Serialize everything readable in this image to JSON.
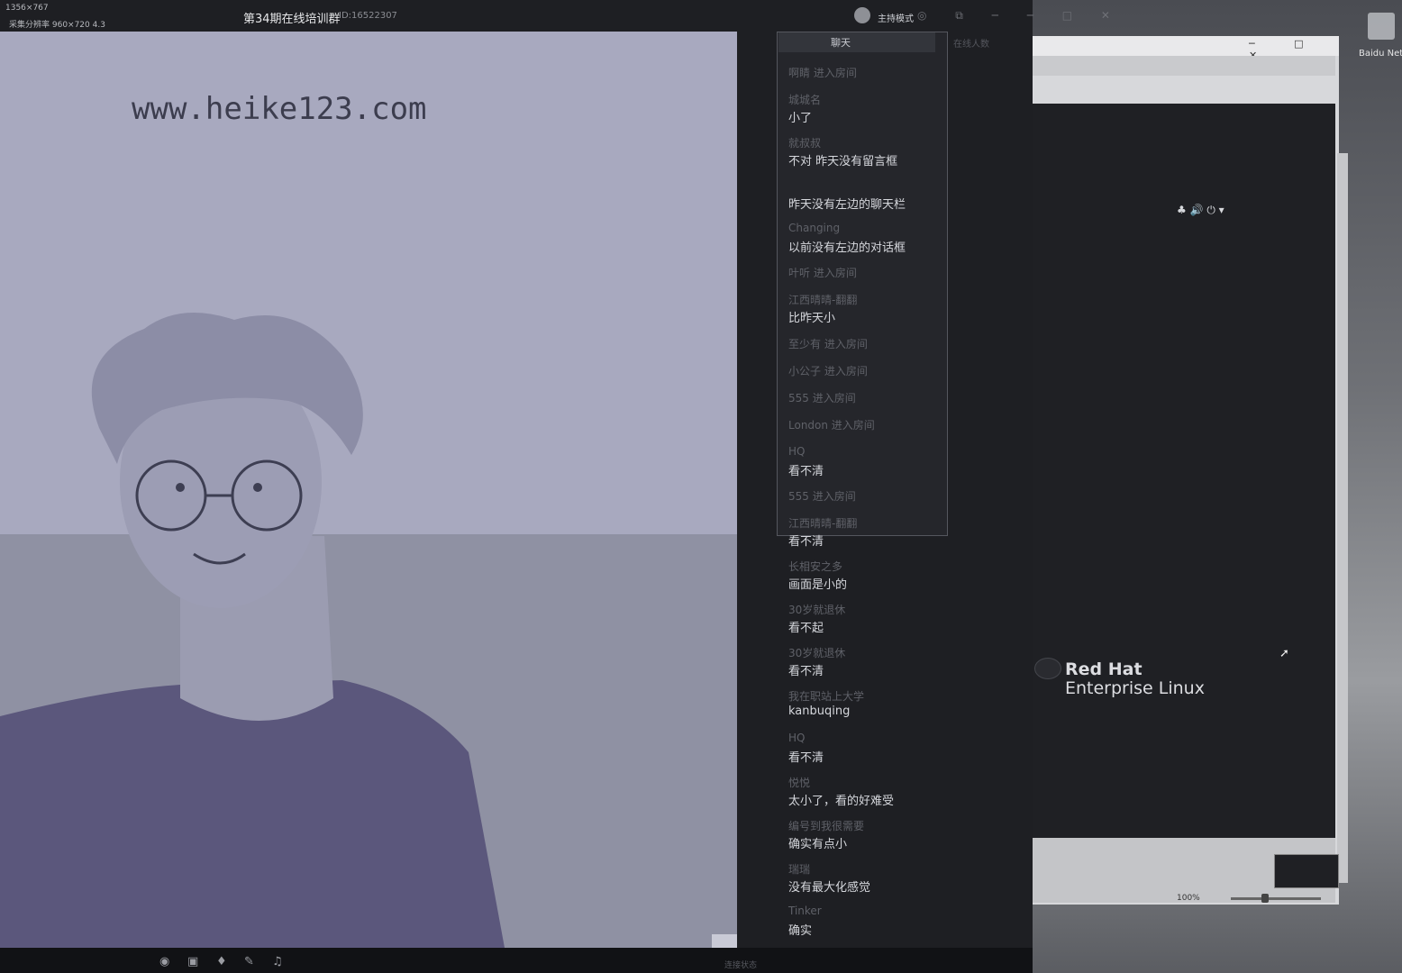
{
  "app": {
    "title": "第34期在线培训群",
    "id_label": "ID:16522307",
    "dimensions": "1356×767",
    "resolution_note": "采集分辨率 960×720 4.3",
    "host_mode": "主持模式",
    "window_icons": "◎ ⧉ ─ ─ □ ✕"
  },
  "video": {
    "watermark": "www.heike123.com"
  },
  "chat": {
    "tab_label": "聊天",
    "tab2_label": "在线人数",
    "messages": [
      {
        "kind": "join",
        "text": "啊睛 进入房间"
      },
      {
        "kind": "msg",
        "name": "城城名",
        "text": "小了"
      },
      {
        "kind": "msg",
        "name": "就叔叔",
        "text": "不对 昨天没有留言框"
      },
      {
        "kind": "msg",
        "name": "",
        "text": "昨天没有左边的聊天栏"
      },
      {
        "kind": "msg",
        "name": "Changing",
        "text": "以前没有左边的对话框"
      },
      {
        "kind": "join",
        "text": "叶听 进入房间"
      },
      {
        "kind": "msg",
        "name": "江西晴晴-翻翻",
        "text": "比昨天小"
      },
      {
        "kind": "join",
        "text": "至少有 进入房间"
      },
      {
        "kind": "join",
        "text": "小公子 进入房间"
      },
      {
        "kind": "join",
        "text": "555 进入房间"
      },
      {
        "kind": "join",
        "text": "London 进入房间"
      },
      {
        "kind": "msg",
        "name": "HQ",
        "text": "看不清"
      },
      {
        "kind": "join",
        "text": "555 进入房间"
      },
      {
        "kind": "msg",
        "name": "江西晴晴-翻翻",
        "text": "看不清"
      },
      {
        "kind": "msg",
        "name": "长相安之多",
        "text": "画面是小的"
      },
      {
        "kind": "msg",
        "name": "30岁就退休",
        "text": "看不起"
      },
      {
        "kind": "msg",
        "name": "30岁就退休",
        "text": "看不清"
      },
      {
        "kind": "msg",
        "name": "我在职站上大学",
        "text": "kanbuqing"
      },
      {
        "kind": "msg",
        "name": "HQ",
        "text": "看不清"
      },
      {
        "kind": "msg",
        "name": "悦悦",
        "text": "太小了，看的好难受"
      },
      {
        "kind": "msg",
        "name": "编号到我很需要",
        "text": "确实有点小"
      },
      {
        "kind": "msg",
        "name": "瑞瑞",
        "text": "没有最大化感觉"
      },
      {
        "kind": "msg",
        "name": "Tinker",
        "text": "确实"
      }
    ],
    "emoji_icon": "☺"
  },
  "vm": {
    "rh_title": "Red Hat",
    "rh_subtitle": "Enterprise Linux",
    "zoom": "100%",
    "status_icons": "♣ 🔊 ⏻ ▾",
    "controls": "─ □ ✕"
  },
  "desktop": {
    "icon_label": "Baidu Net"
  },
  "bottombar": {
    "status": "连接状态"
  }
}
